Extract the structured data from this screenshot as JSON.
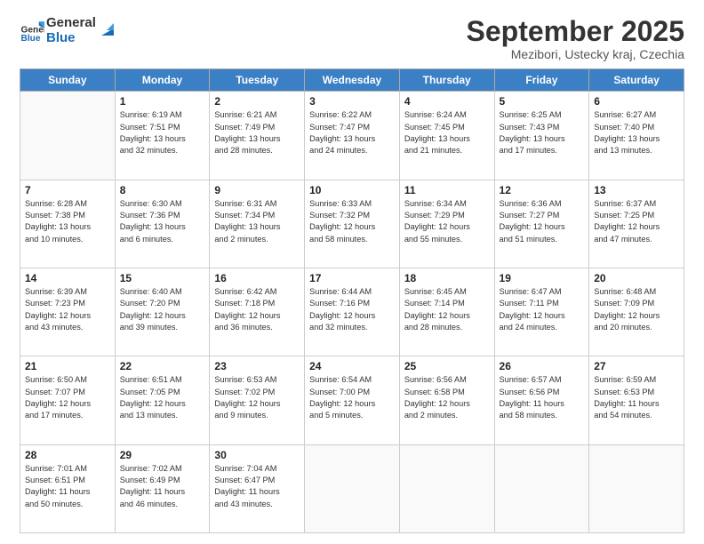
{
  "header": {
    "logo_general": "General",
    "logo_blue": "Blue",
    "month_title": "September 2025",
    "location": "Mezibori, Ustecky kraj, Czechia"
  },
  "weekdays": [
    "Sunday",
    "Monday",
    "Tuesday",
    "Wednesday",
    "Thursday",
    "Friday",
    "Saturday"
  ],
  "weeks": [
    [
      {
        "day": "",
        "info": ""
      },
      {
        "day": "1",
        "info": "Sunrise: 6:19 AM\nSunset: 7:51 PM\nDaylight: 13 hours\nand 32 minutes."
      },
      {
        "day": "2",
        "info": "Sunrise: 6:21 AM\nSunset: 7:49 PM\nDaylight: 13 hours\nand 28 minutes."
      },
      {
        "day": "3",
        "info": "Sunrise: 6:22 AM\nSunset: 7:47 PM\nDaylight: 13 hours\nand 24 minutes."
      },
      {
        "day": "4",
        "info": "Sunrise: 6:24 AM\nSunset: 7:45 PM\nDaylight: 13 hours\nand 21 minutes."
      },
      {
        "day": "5",
        "info": "Sunrise: 6:25 AM\nSunset: 7:43 PM\nDaylight: 13 hours\nand 17 minutes."
      },
      {
        "day": "6",
        "info": "Sunrise: 6:27 AM\nSunset: 7:40 PM\nDaylight: 13 hours\nand 13 minutes."
      }
    ],
    [
      {
        "day": "7",
        "info": "Sunrise: 6:28 AM\nSunset: 7:38 PM\nDaylight: 13 hours\nand 10 minutes."
      },
      {
        "day": "8",
        "info": "Sunrise: 6:30 AM\nSunset: 7:36 PM\nDaylight: 13 hours\nand 6 minutes."
      },
      {
        "day": "9",
        "info": "Sunrise: 6:31 AM\nSunset: 7:34 PM\nDaylight: 13 hours\nand 2 minutes."
      },
      {
        "day": "10",
        "info": "Sunrise: 6:33 AM\nSunset: 7:32 PM\nDaylight: 12 hours\nand 58 minutes."
      },
      {
        "day": "11",
        "info": "Sunrise: 6:34 AM\nSunset: 7:29 PM\nDaylight: 12 hours\nand 55 minutes."
      },
      {
        "day": "12",
        "info": "Sunrise: 6:36 AM\nSunset: 7:27 PM\nDaylight: 12 hours\nand 51 minutes."
      },
      {
        "day": "13",
        "info": "Sunrise: 6:37 AM\nSunset: 7:25 PM\nDaylight: 12 hours\nand 47 minutes."
      }
    ],
    [
      {
        "day": "14",
        "info": "Sunrise: 6:39 AM\nSunset: 7:23 PM\nDaylight: 12 hours\nand 43 minutes."
      },
      {
        "day": "15",
        "info": "Sunrise: 6:40 AM\nSunset: 7:20 PM\nDaylight: 12 hours\nand 39 minutes."
      },
      {
        "day": "16",
        "info": "Sunrise: 6:42 AM\nSunset: 7:18 PM\nDaylight: 12 hours\nand 36 minutes."
      },
      {
        "day": "17",
        "info": "Sunrise: 6:44 AM\nSunset: 7:16 PM\nDaylight: 12 hours\nand 32 minutes."
      },
      {
        "day": "18",
        "info": "Sunrise: 6:45 AM\nSunset: 7:14 PM\nDaylight: 12 hours\nand 28 minutes."
      },
      {
        "day": "19",
        "info": "Sunrise: 6:47 AM\nSunset: 7:11 PM\nDaylight: 12 hours\nand 24 minutes."
      },
      {
        "day": "20",
        "info": "Sunrise: 6:48 AM\nSunset: 7:09 PM\nDaylight: 12 hours\nand 20 minutes."
      }
    ],
    [
      {
        "day": "21",
        "info": "Sunrise: 6:50 AM\nSunset: 7:07 PM\nDaylight: 12 hours\nand 17 minutes."
      },
      {
        "day": "22",
        "info": "Sunrise: 6:51 AM\nSunset: 7:05 PM\nDaylight: 12 hours\nand 13 minutes."
      },
      {
        "day": "23",
        "info": "Sunrise: 6:53 AM\nSunset: 7:02 PM\nDaylight: 12 hours\nand 9 minutes."
      },
      {
        "day": "24",
        "info": "Sunrise: 6:54 AM\nSunset: 7:00 PM\nDaylight: 12 hours\nand 5 minutes."
      },
      {
        "day": "25",
        "info": "Sunrise: 6:56 AM\nSunset: 6:58 PM\nDaylight: 12 hours\nand 2 minutes."
      },
      {
        "day": "26",
        "info": "Sunrise: 6:57 AM\nSunset: 6:56 PM\nDaylight: 11 hours\nand 58 minutes."
      },
      {
        "day": "27",
        "info": "Sunrise: 6:59 AM\nSunset: 6:53 PM\nDaylight: 11 hours\nand 54 minutes."
      }
    ],
    [
      {
        "day": "28",
        "info": "Sunrise: 7:01 AM\nSunset: 6:51 PM\nDaylight: 11 hours\nand 50 minutes."
      },
      {
        "day": "29",
        "info": "Sunrise: 7:02 AM\nSunset: 6:49 PM\nDaylight: 11 hours\nand 46 minutes."
      },
      {
        "day": "30",
        "info": "Sunrise: 7:04 AM\nSunset: 6:47 PM\nDaylight: 11 hours\nand 43 minutes."
      },
      {
        "day": "",
        "info": ""
      },
      {
        "day": "",
        "info": ""
      },
      {
        "day": "",
        "info": ""
      },
      {
        "day": "",
        "info": ""
      }
    ]
  ]
}
